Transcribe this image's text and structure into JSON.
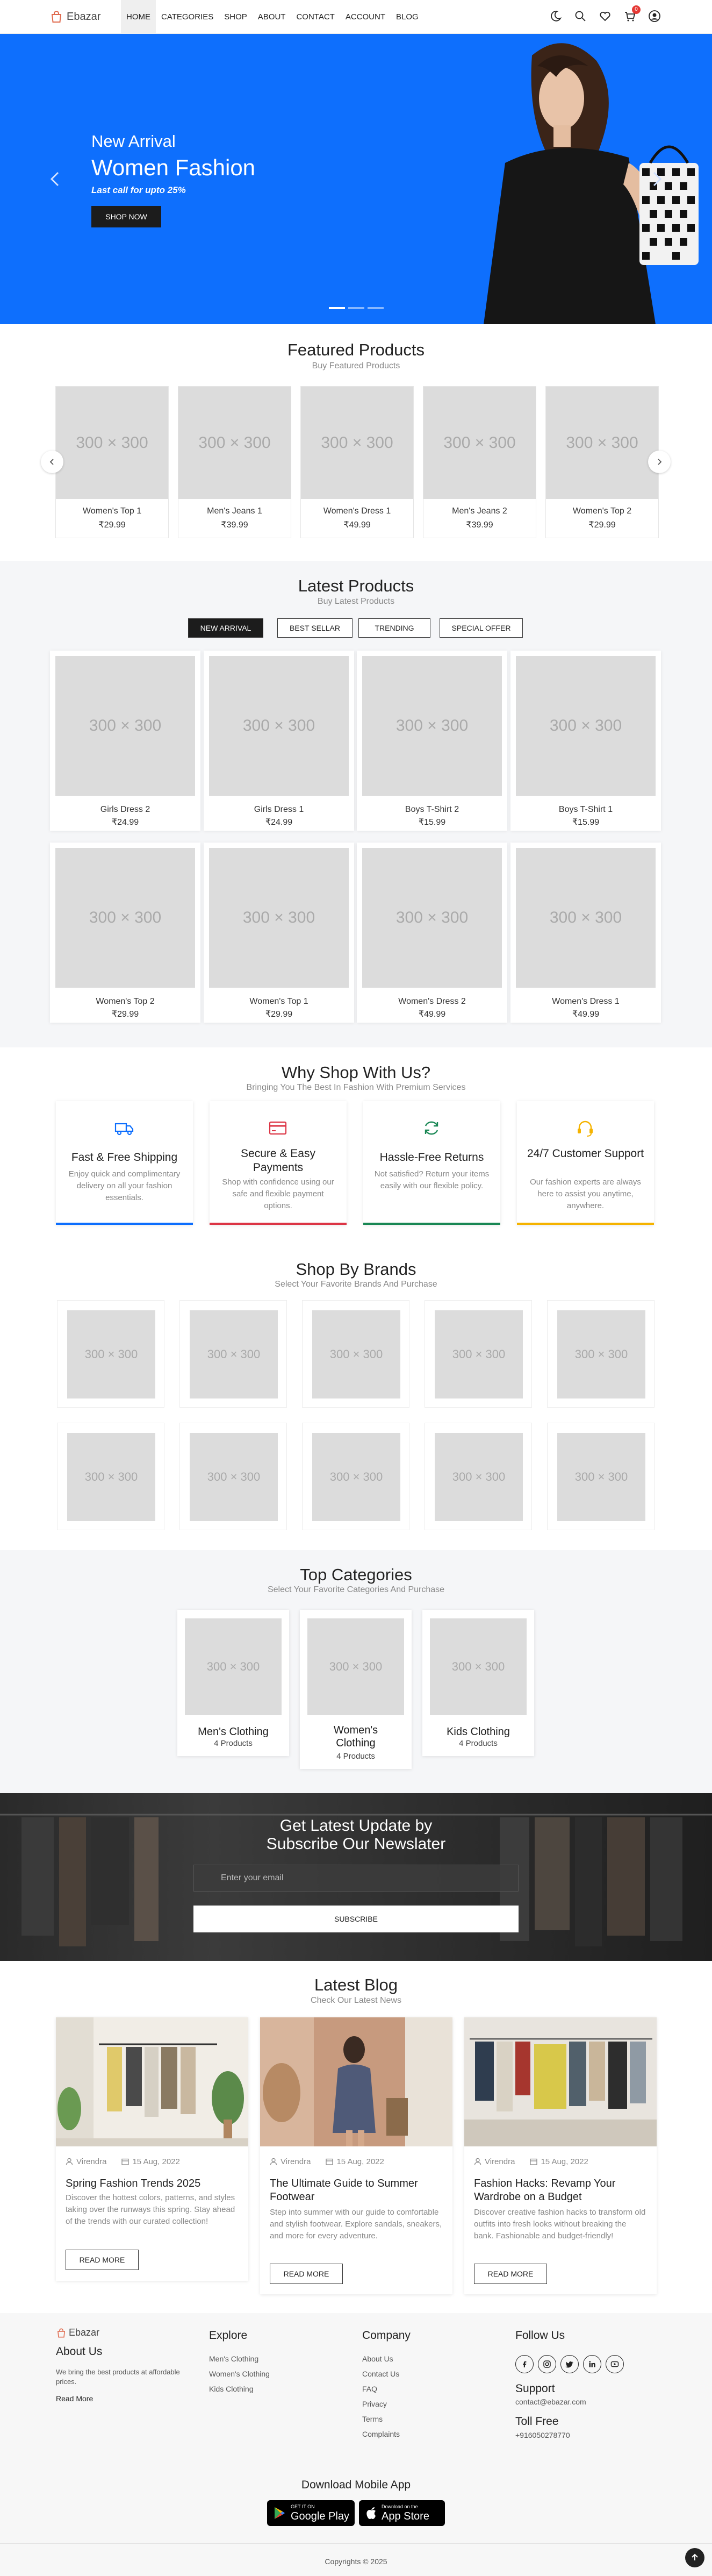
{
  "header": {
    "logo_text": "Ebazar",
    "nav": [
      "HOME",
      "CATEGORIES",
      "SHOP",
      "ABOUT",
      "CONTACT",
      "ACCOUNT",
      "BLOG"
    ],
    "active_nav": "HOME",
    "cart_count": "0",
    "icons": [
      "moon-icon",
      "search-icon",
      "heart-icon",
      "cart-icon",
      "user-icon"
    ]
  },
  "hero": {
    "subtitle": "New Arrival",
    "title": "Women Fashion",
    "tagline": "Last call for upto 25%",
    "button": "SHOP NOW",
    "bg_color": "#0e6ffd"
  },
  "featured": {
    "title": "Featured Products",
    "subtitle": "Buy Featured Products",
    "items": [
      {
        "image": "300 × 300",
        "name": "Women's Top 1",
        "price": "₹29.99"
      },
      {
        "image": "300 × 300",
        "name": "Men's Jeans 1",
        "price": "₹39.99"
      },
      {
        "image": "300 × 300",
        "name": "Women's Dress 1",
        "price": "₹49.99"
      },
      {
        "image": "300 × 300",
        "name": "Men's Jeans 2",
        "price": "₹39.99"
      },
      {
        "image": "300 × 300",
        "name": "Women's Top 2",
        "price": "₹29.99"
      }
    ]
  },
  "latest": {
    "title": "Latest Products",
    "subtitle": "Buy Latest Products",
    "tabs": [
      "NEW ARRIVAL",
      "BEST SELLAR",
      "TRENDING",
      "SPECIAL OFFER"
    ],
    "active_tab": "NEW ARRIVAL",
    "items": [
      {
        "image": "300 × 300",
        "name": "Girls Dress 2",
        "price": "₹24.99"
      },
      {
        "image": "300 × 300",
        "name": "Girls Dress 1",
        "price": "₹24.99"
      },
      {
        "image": "300 × 300",
        "name": "Boys T-Shirt 2",
        "price": "₹15.99"
      },
      {
        "image": "300 × 300",
        "name": "Boys T-Shirt 1",
        "price": "₹15.99"
      },
      {
        "image": "300 × 300",
        "name": "Women's Top 2",
        "price": "₹29.99"
      },
      {
        "image": "300 × 300",
        "name": "Women's Top 1",
        "price": "₹29.99"
      },
      {
        "image": "300 × 300",
        "name": "Women's Dress 2",
        "price": "₹49.99"
      },
      {
        "image": "300 × 300",
        "name": "Women's Dress 1",
        "price": "₹49.99"
      }
    ]
  },
  "why": {
    "title": "Why Shop With Us?",
    "subtitle": "Bringing You The Best In Fashion With Premium Services",
    "items": [
      {
        "icon": "truck-icon",
        "title": "Fast & Free Shipping",
        "text": "Enjoy quick and complimentary delivery on all your fashion essentials.",
        "color": "#0d6efd"
      },
      {
        "icon": "credit-card-icon",
        "title": "Secure & Easy Payments",
        "text": "Shop with confidence using our safe and flexible payment options.",
        "color": "#dc3545"
      },
      {
        "icon": "refresh-icon",
        "title": "Hassle-Free Returns",
        "text": "Not satisfied? Return your items easily with our flexible policy.",
        "color": "#198754"
      },
      {
        "icon": "headset-icon",
        "title": "24/7 Customer Support",
        "text": "Our fashion experts are always here to assist you anytime, anywhere.",
        "color": "#f5b300"
      }
    ]
  },
  "brands": {
    "title": "Shop By Brands",
    "subtitle": "Select Your Favorite Brands And Purchase",
    "placeholder": "300 × 300"
  },
  "categories": {
    "title": "Top Categories",
    "subtitle": "Select Your Favorite Categories And Purchase",
    "items": [
      {
        "image": "300 × 300",
        "name": "Men's Clothing",
        "count": "4 Products"
      },
      {
        "image": "300 × 300",
        "name": "Women's Clothing",
        "count": "4 Products"
      },
      {
        "image": "300 × 300",
        "name": "Kids Clothing",
        "count": "4 Products"
      }
    ]
  },
  "newsletter": {
    "title": "Get Latest Update by Subscribe Our Newslater",
    "placeholder": "Enter your email",
    "button": "SUBSCRIBE"
  },
  "blog": {
    "title": "Latest Blog",
    "subtitle": "Check Our Latest News",
    "posts": [
      {
        "author": "Virendra",
        "date": "15 Aug, 2022",
        "title": "Spring Fashion Trends 2025",
        "text": "Discover the hottest colors, patterns, and styles taking over the runways this spring. Stay ahead of the trends with our curated collection!",
        "button": "READ MORE"
      },
      {
        "author": "Virendra",
        "date": "15 Aug, 2022",
        "title": "The Ultimate Guide to Summer Footwear",
        "text": "Step into summer with our guide to comfortable and stylish footwear. Explore sandals, sneakers, and more for every adventure.",
        "button": "READ MORE"
      },
      {
        "author": "Virendra",
        "date": "15 Aug, 2022",
        "title": "Fashion Hacks: Revamp Your Wardrobe on a Budget",
        "text": "Discover creative fashion hacks to transform old outfits into fresh looks without breaking the bank. Fashionable and budget-friendly!",
        "button": "READ MORE"
      }
    ]
  },
  "footer": {
    "logo_text": "Ebazar",
    "about_title": "About Us",
    "about_text": "We bring the best products at affordable prices.",
    "read_more": "Read More",
    "explore_title": "Explore",
    "explore_links": [
      "Men's Clothing",
      "Women's Clothing",
      "Kids Clothing"
    ],
    "company_title": "Company",
    "company_links": [
      "About Us",
      "Contact Us",
      "FAQ",
      "Privacy",
      "Terms",
      "Complaints"
    ],
    "follow_title": "Follow Us",
    "social_icons": [
      "facebook-icon",
      "instagram-icon",
      "twitter-icon",
      "linkedin-icon",
      "youtube-icon"
    ],
    "support_title": "Support",
    "support_email": "contact@ebazar.com",
    "tollfree_title": "Toll Free",
    "tollfree_number": "+916050278770",
    "download_title": "Download Mobile App",
    "google_small": "GET IT ON",
    "google_big": "Google Play",
    "apple_small": "Download on the",
    "apple_big": "App Store",
    "copyright": "Copyrights © 2025"
  }
}
